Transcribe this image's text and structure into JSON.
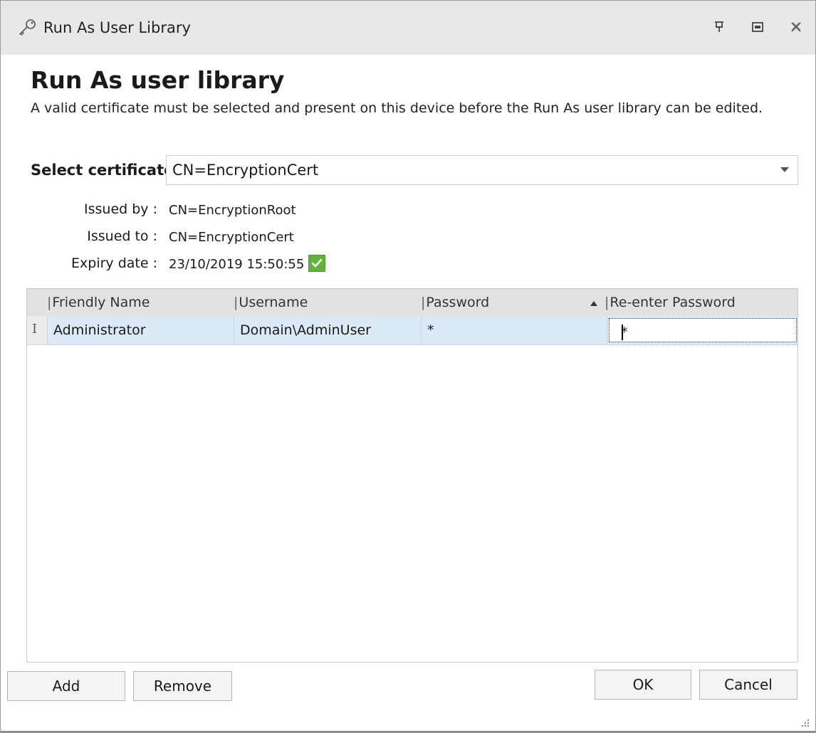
{
  "window": {
    "title": "Run As User Library",
    "icons": [
      "key-icon",
      "pin-icon",
      "restore-icon",
      "close-icon"
    ]
  },
  "header": {
    "title": "Run As user library",
    "description": "A valid certificate must be selected and present on this device before the Run As user library can be edited."
  },
  "certificate": {
    "label": "Select certificate",
    "selected": "CN=EncryptionCert",
    "issued_by_label": "Issued by :",
    "issued_by": "CN=EncryptionRoot",
    "issued_to_label": "Issued to :",
    "issued_to": "CN=EncryptionCert",
    "expiry_label": "Expiry date :",
    "expiry": "23/10/2019 15:50:55",
    "valid_icon": "check-icon",
    "valid_color": "#5fb336"
  },
  "grid": {
    "columns": [
      "Friendly Name",
      "Username",
      "Password",
      "Re-enter Password"
    ],
    "sorted_column": "Password",
    "sort_direction": "ascending",
    "rows": [
      {
        "indicator": "I",
        "friendly_name": "Administrator",
        "username": "Domain\\AdminUser",
        "password": "*",
        "reenter_password": "*"
      }
    ]
  },
  "buttons": {
    "add": "Add",
    "remove": "Remove",
    "ok": "OK",
    "cancel": "Cancel"
  }
}
